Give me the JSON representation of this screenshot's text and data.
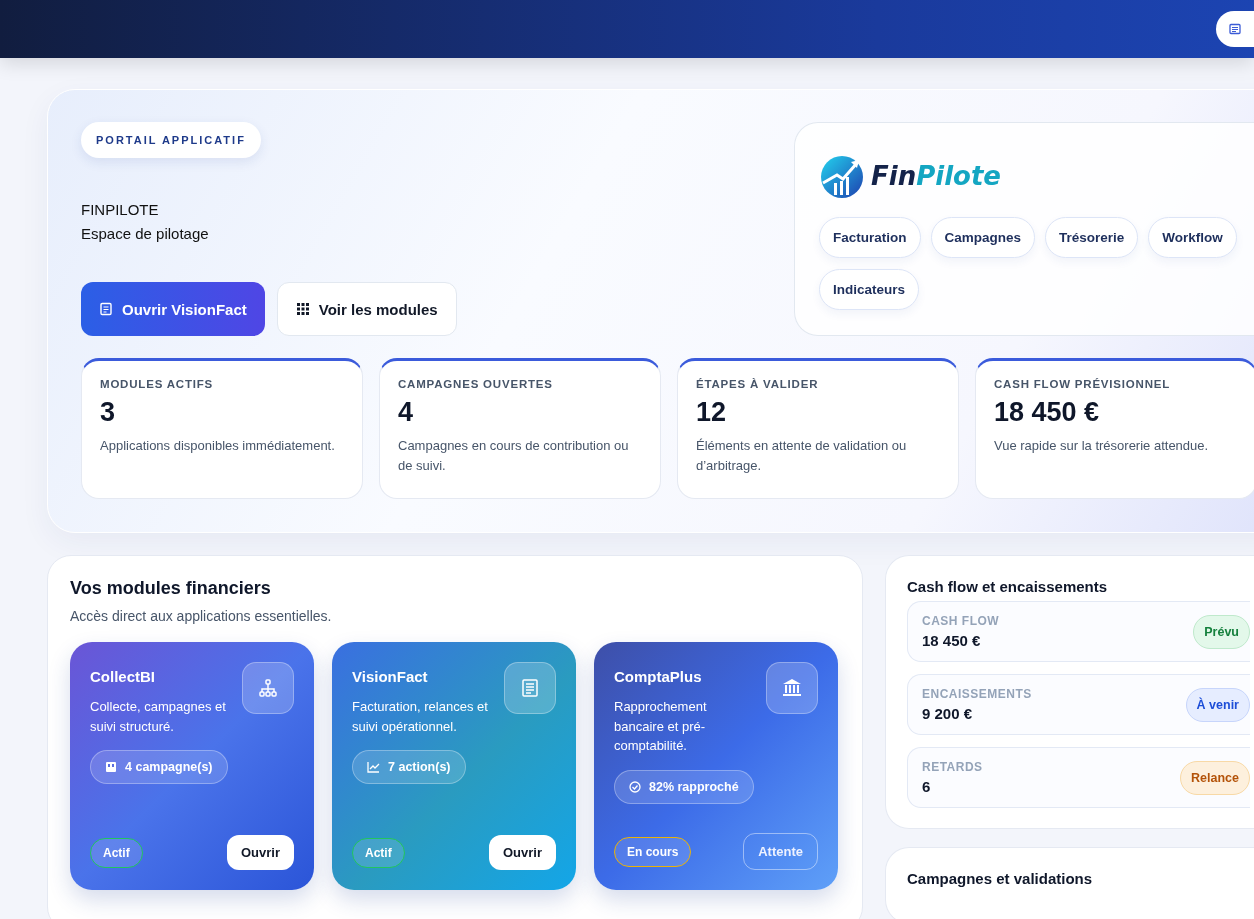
{
  "hero": {
    "badge": "PORTAIL APPLICATIF",
    "title": "FINPILOTE",
    "subtitle": "Espace de pilotage",
    "actions": [
      {
        "label": "Ouvrir VisionFact",
        "kind": "primary"
      },
      {
        "label": "Voir les modules",
        "kind": "secondary"
      }
    ],
    "brand": {
      "name_start": "Fin",
      "name_end": "Pilote"
    },
    "chips": [
      "Facturation",
      "Campagnes",
      "Trésorerie",
      "Workflow",
      "Indicateurs"
    ]
  },
  "stats": [
    {
      "label": "MODULES ACTIFS",
      "value": "3",
      "note": "Applications disponibles immédiatement."
    },
    {
      "label": "CAMPAGNES OUVERTES",
      "value": "4",
      "note": "Campagnes en cours de contribution ou de suivi."
    },
    {
      "label": "ÉTAPES À VALIDER",
      "value": "12",
      "note": "Éléments en attente de validation ou d’arbitrage."
    },
    {
      "label": "CASH FLOW PRÉVISIONNEL",
      "value": "18 450 €",
      "note": "Vue rapide sur la trésorerie attendue."
    }
  ],
  "modules": {
    "title": "Vos modules financiers",
    "subtitle": "Accès direct aux applications essentielles.",
    "cards": [
      {
        "name": "CollectBI",
        "description": "Collecte, campagnes et suivi structuré.",
        "metric": "4 campagne(s)",
        "status": {
          "label": "Actif",
          "color": "#22c55e"
        },
        "button": {
          "label": "Ouvrir",
          "disabled": false
        }
      },
      {
        "name": "VisionFact",
        "description": "Facturation, relances et suivi opérationnel.",
        "metric": "7 action(s)",
        "status": {
          "label": "Actif",
          "color": "#22c55e"
        },
        "button": {
          "label": "Ouvrir",
          "disabled": false
        }
      },
      {
        "name": "ComptaPlus",
        "description": "Rapprochement bancaire et pré-comptabilité.",
        "metric": "82% rapproché",
        "status": {
          "label": "En cours",
          "color": "#eab308"
        },
        "button": {
          "label": "Attente",
          "disabled": true
        }
      }
    ]
  },
  "cash": {
    "title": "Cash flow et encaissements",
    "items": [
      {
        "label": "CASH FLOW",
        "value": "18 450 €",
        "tag": "Prévu",
        "kind": "success"
      },
      {
        "label": "ENCAISSEMENTS",
        "value": "9 200 €",
        "tag": "À venir",
        "kind": "info"
      },
      {
        "label": "RETARDS",
        "value": "6",
        "tag": "Relance",
        "kind": "warning"
      }
    ]
  },
  "campaigns": {
    "title": "Campagnes et validations"
  }
}
